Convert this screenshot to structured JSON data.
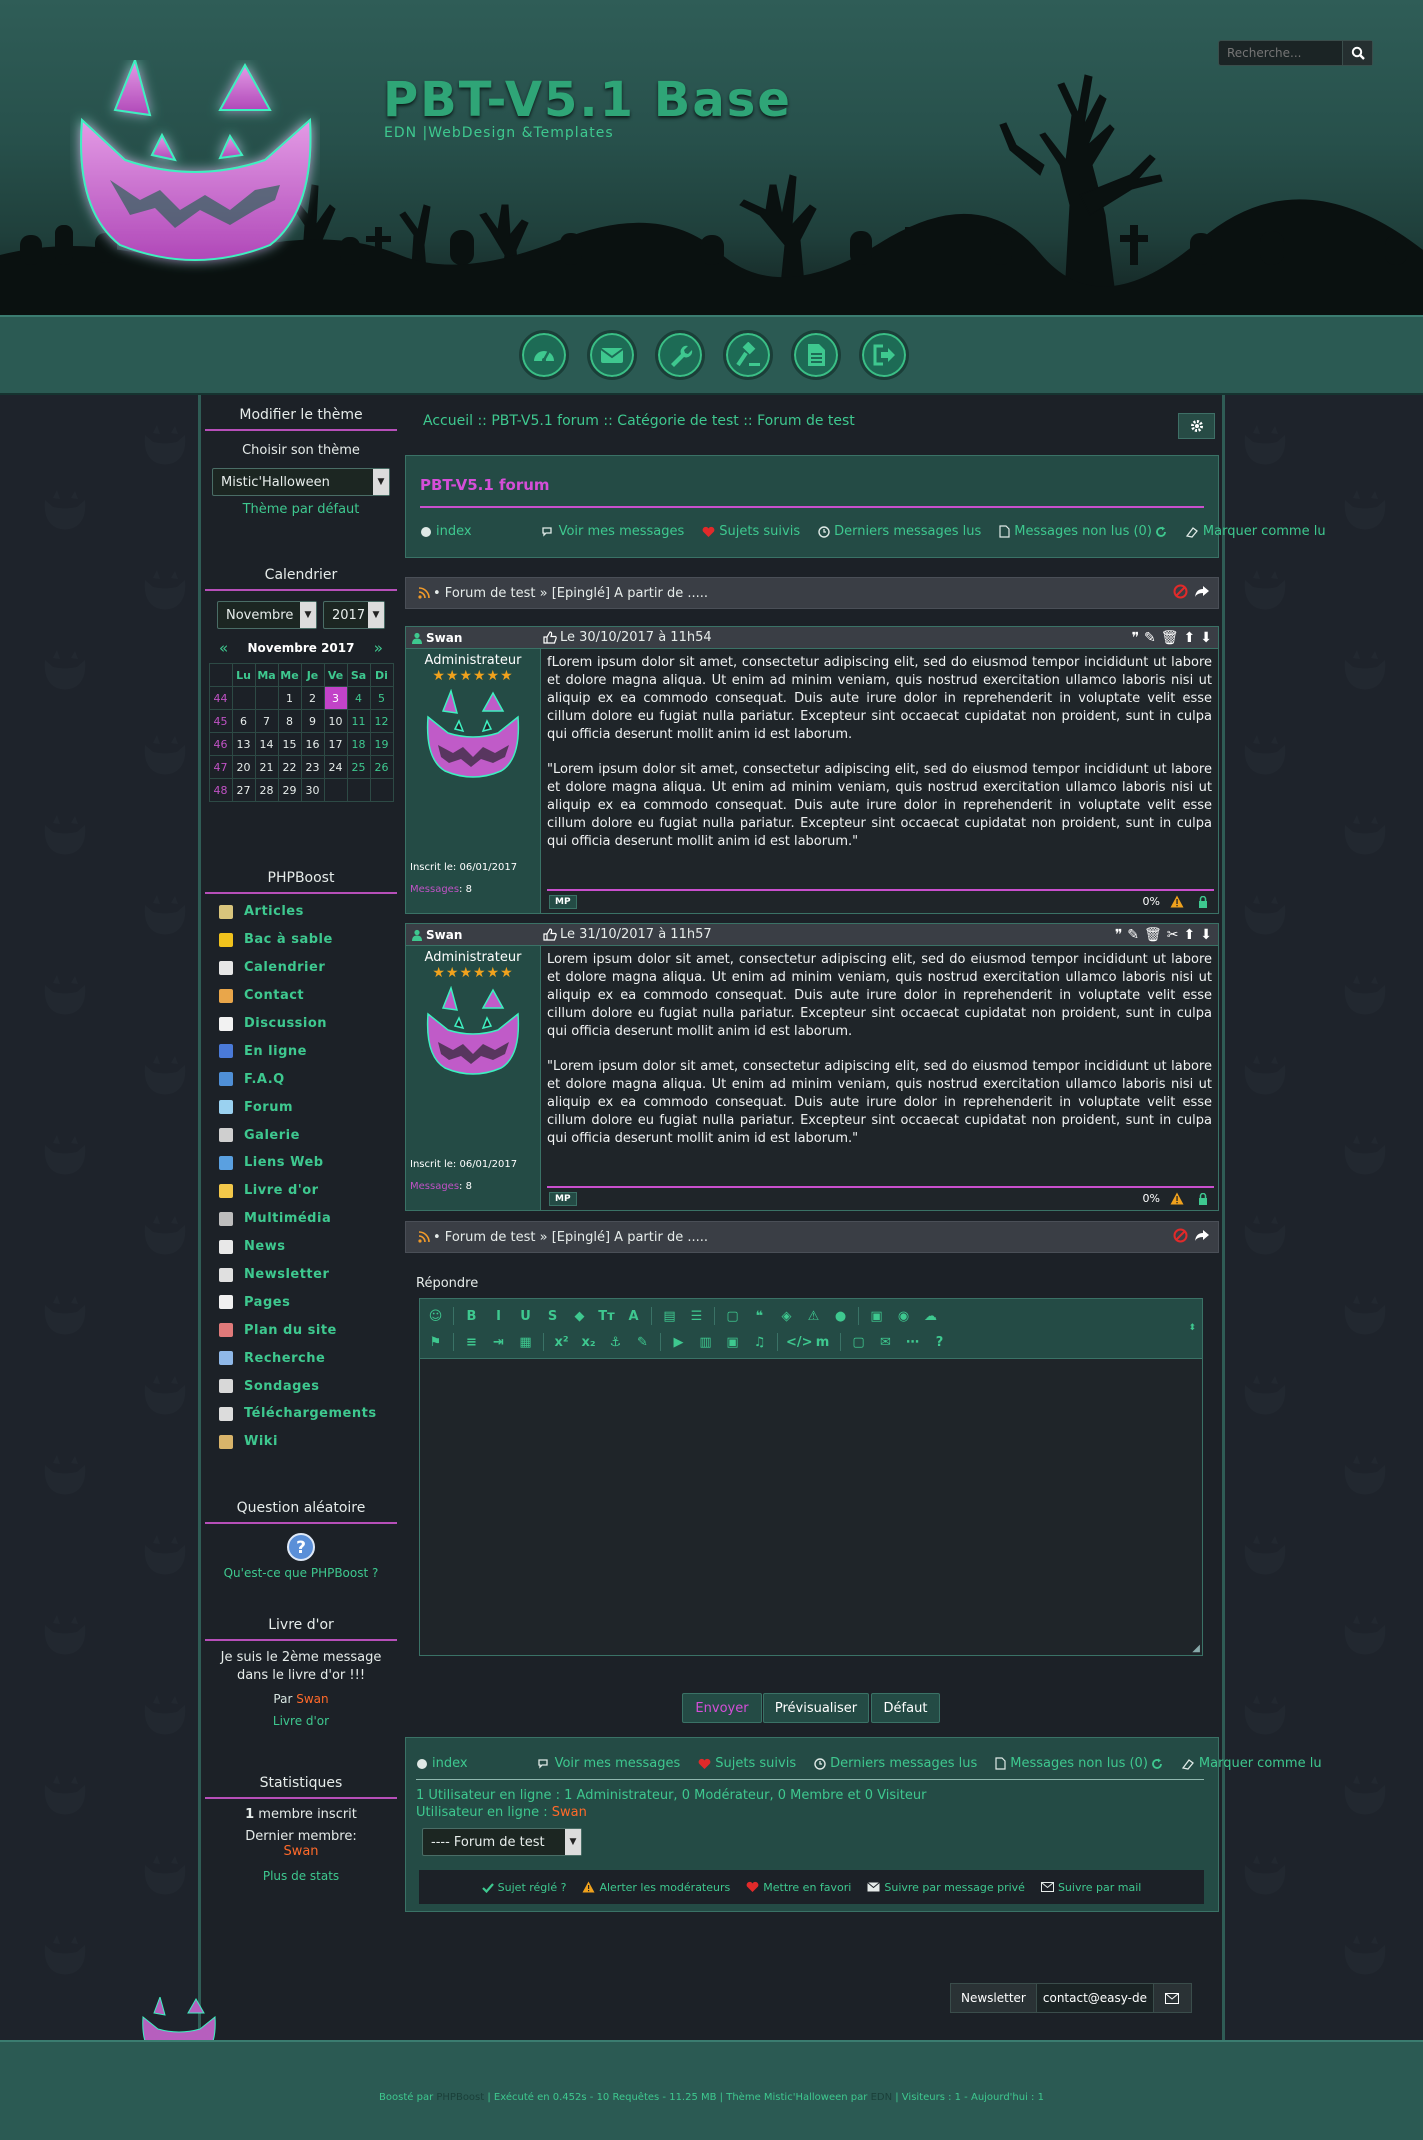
{
  "header": {
    "title": "PBT-V5.1 Base",
    "subtitle": "EDN |WebDesign &Templates",
    "search_placeholder": "Recherche..."
  },
  "nav_icons": [
    "dashboard-icon",
    "envelope-icon",
    "wrench-icon",
    "gavel-icon",
    "document-icon",
    "logout-icon"
  ],
  "sidebar": {
    "theme": {
      "title": "Modifier le thème",
      "label": "Choisir son thème",
      "selected": "Mistic'Halloween",
      "default_link": "Thème par défaut"
    },
    "calendar": {
      "title": "Calendrier",
      "month_select": "Novembre",
      "year_select": "2017",
      "heading": "Novembre 2017",
      "prev": "«",
      "next": "»",
      "days": [
        "Lu",
        "Ma",
        "Me",
        "Je",
        "Ve",
        "Sa",
        "Di"
      ],
      "weeks": [
        {
          "w": "44",
          "d": [
            "",
            "",
            "1",
            "2",
            "3",
            "4",
            "5"
          ]
        },
        {
          "w": "45",
          "d": [
            "6",
            "7",
            "8",
            "9",
            "10",
            "11",
            "12"
          ]
        },
        {
          "w": "46",
          "d": [
            "13",
            "14",
            "15",
            "16",
            "17",
            "18",
            "19"
          ]
        },
        {
          "w": "47",
          "d": [
            "20",
            "21",
            "22",
            "23",
            "24",
            "25",
            "26"
          ]
        },
        {
          "w": "48",
          "d": [
            "27",
            "28",
            "29",
            "30",
            "",
            "",
            ""
          ]
        }
      ],
      "today": "3"
    },
    "menu": {
      "title": "PHPBoost",
      "items": [
        {
          "label": "Articles",
          "color": "#d9c57c"
        },
        {
          "label": "Bac à sable",
          "color": "#f0c21d"
        },
        {
          "label": "Calendrier",
          "color": "#e6e6e6"
        },
        {
          "label": "Contact",
          "color": "#e9a64a"
        },
        {
          "label": "Discussion",
          "color": "#f2f2f2"
        },
        {
          "label": "En ligne",
          "color": "#4a7ad8"
        },
        {
          "label": "F.A.Q",
          "color": "#4f8fd6"
        },
        {
          "label": "Forum",
          "color": "#9ad1f0"
        },
        {
          "label": "Galerie",
          "color": "#cfcfcf"
        },
        {
          "label": "Liens Web",
          "color": "#5aa0e0"
        },
        {
          "label": "Livre d'or",
          "color": "#f3c84a"
        },
        {
          "label": "Multimédia",
          "color": "#bdbdbd"
        },
        {
          "label": "News",
          "color": "#e8e8e8"
        },
        {
          "label": "Newsletter",
          "color": "#e0e0e0"
        },
        {
          "label": "Pages",
          "color": "#f0f0f0"
        },
        {
          "label": "Plan du site",
          "color": "#e07a7a"
        },
        {
          "label": "Recherche",
          "color": "#8fb8e8"
        },
        {
          "label": "Sondages",
          "color": "#d8d8d8"
        },
        {
          "label": "Téléchargements",
          "color": "#dcdcdc"
        },
        {
          "label": "Wiki",
          "color": "#d9b46a"
        }
      ]
    },
    "question": {
      "title": "Question aléatoire",
      "link": "Qu'est-ce que PHPBoost ?"
    },
    "guestbook": {
      "title": "Livre d'or",
      "message": "Je suis le 2ème message dans le livre d'or !!!",
      "by": "Par",
      "author": "Swan",
      "link": "Livre d'or"
    },
    "stats": {
      "title": "Statistiques",
      "members_count": "1",
      "members_label": "membre inscrit",
      "last_member_label": "Dernier membre:",
      "last_member": "Swan",
      "more": "Plus de stats"
    }
  },
  "breadcrumb": {
    "items": [
      "Accueil",
      "PBT-V5.1 forum",
      "Catégorie de test",
      "Forum de test"
    ],
    "sep": "::"
  },
  "forum": {
    "title": "PBT-V5.1 forum",
    "links": {
      "index": "index",
      "my_messages": "Voir mes messages",
      "followed": "Sujets suivis",
      "last_read": "Derniers messages lus",
      "unread": "Messages non lus (0)",
      "mark_read": "Marquer comme lu"
    },
    "topic_bar": "• Forum de test » [Epinglé] A partir de ....."
  },
  "posts": [
    {
      "user": "Swan",
      "date": "Le 30/10/2017 à 11h54",
      "role": "Administrateur",
      "registered": "Inscrit le: 06/01/2017",
      "messages_label": "Messages",
      "messages_count": ": 8",
      "paragraphs": [
        "fLorem ipsum dolor sit amet, consectetur adipiscing elit, sed do eiusmod tempor incididunt ut labore et dolore magna aliqua. Ut enim ad minim veniam, quis nostrud exercitation ullamco laboris nisi ut aliquip ex ea commodo consequat. Duis aute irure dolor in reprehenderit in voluptate velit esse cillum dolore eu fugiat nulla pariatur. Excepteur sint occaecat cupidatat non proident, sunt in culpa qui officia deserunt mollit anim id est laborum.",
        "\"Lorem ipsum dolor sit amet, consectetur adipiscing elit, sed do eiusmod tempor incididunt ut labore et dolore magna aliqua. Ut enim ad minim veniam, quis nostrud exercitation ullamco laboris nisi ut aliquip ex ea commodo consequat. Duis aute irure dolor in reprehenderit in voluptate velit esse cillum dolore eu fugiat nulla pariatur. Excepteur sint occaecat cupidatat non proident, sunt in culpa qui officia deserunt mollit anim id est laborum.\""
      ],
      "mp": "MP",
      "pct": "0%"
    },
    {
      "user": "Swan",
      "date": "Le 31/10/2017 à 11h57",
      "role": "Administrateur",
      "registered": "Inscrit le: 06/01/2017",
      "messages_label": "Messages",
      "messages_count": ": 8",
      "paragraphs": [
        "Lorem ipsum dolor sit amet, consectetur adipiscing elit, sed do eiusmod tempor incididunt ut labore et dolore magna aliqua. Ut enim ad minim veniam, quis nostrud exercitation ullamco laboris nisi ut aliquip ex ea commodo consequat. Duis aute irure dolor in reprehenderit in voluptate velit esse cillum dolore eu fugiat nulla pariatur. Excepteur sint occaecat cupidatat non proident, sunt in culpa qui officia deserunt mollit anim id est laborum.",
        "\"Lorem ipsum dolor sit amet, consectetur adipiscing elit, sed do eiusmod tempor incididunt ut labore et dolore magna aliqua. Ut enim ad minim veniam, quis nostrud exercitation ullamco laboris nisi ut aliquip ex ea commodo consequat. Duis aute irure dolor in reprehenderit in voluptate velit esse cillum dolore eu fugiat nulla pariatur. Excepteur sint occaecat cupidatat non proident, sunt in culpa qui officia deserunt mollit anim id est laborum.\""
      ],
      "mp": "MP",
      "pct": "0%"
    }
  ],
  "reply": {
    "label": "Répondre",
    "toolbar_row1": [
      "☺",
      "B",
      "I",
      "U",
      "S",
      "◆",
      "Tᴛ",
      "A",
      "▤",
      "☰",
      "▢",
      "❝",
      "◈",
      "⚠",
      "●",
      "▣",
      "◉",
      "☁"
    ],
    "toolbar_row2": [
      "⚑",
      "≡",
      "⇥",
      "▦",
      "x²",
      "x₂",
      "⚓",
      "✎",
      "▶",
      "▥",
      "▣",
      "♫",
      "</>",
      "m",
      "▢",
      "✉",
      "⋯",
      "?"
    ],
    "send": "Envoyer",
    "preview": "Prévisualiser",
    "default": "Défaut"
  },
  "bottom": {
    "online_text": "1 Utilisateur en ligne : 1 Administrateur, 0 Modérateur, 0 Membre et 0 Visiteur",
    "online_label": "Utilisateur en ligne :",
    "online_user": "Swan",
    "forum_select": "---- Forum de test",
    "follow": {
      "solved": "Sujet réglé ?",
      "alert": "Alerter les modérateurs",
      "fav": "Mettre en favori",
      "pm": "Suivre par message privé",
      "mail": "Suivre par mail"
    }
  },
  "newsletter": {
    "label": "Newsletter",
    "value": "contact@easy-de"
  },
  "footer": {
    "powered": "Boosté par",
    "phpboost": "PHPBoost",
    "exec": "| Exécuté en 0.452s - 10 Requêtes - 11.25 MB | Thème Mistic'Halloween par",
    "edn": "EDN",
    "visitors": "| Visiteurs : 1 - Aujourd'hui : 1"
  },
  "colors": {
    "accent_green": "#3ec88f",
    "accent_purple": "#c94fcd",
    "panel_teal": "#244b45",
    "orange": "#ff6a2a"
  }
}
